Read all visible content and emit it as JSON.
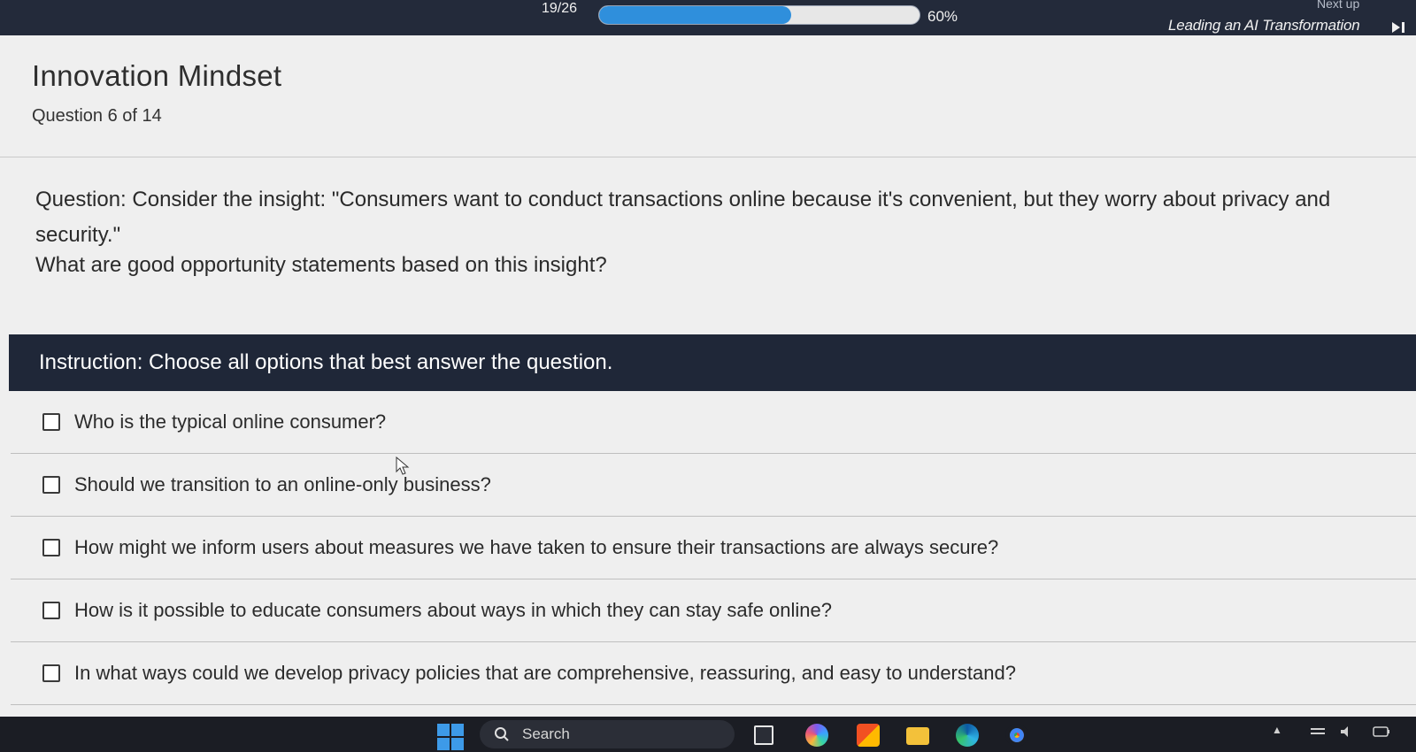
{
  "header": {
    "progress_count": "19/26",
    "progress_fraction": 0.6,
    "progress_percent": "60%",
    "next_up_label": "Next up",
    "next_up_title": "Leading an AI Transformation"
  },
  "quiz": {
    "title": "Innovation Mindset",
    "progress": "Question 6 of 14",
    "question_label": "Question:",
    "question_text": "Consider the insight: \"Consumers want to conduct transactions online because it's convenient, but they worry about privacy and security.\"",
    "question_prompt": "What are good opportunity statements based on this insight?",
    "instruction": "Instruction: Choose all options that best answer the question.",
    "options": [
      {
        "label": "Who is the typical online consumer?",
        "checked": false
      },
      {
        "label": "Should we transition to an online-only business?",
        "checked": false
      },
      {
        "label": "How might we inform users about measures we have taken to ensure their transactions are always secure?",
        "checked": false
      },
      {
        "label": "How is it possible to educate consumers about ways in which they can stay safe online?",
        "checked": false
      },
      {
        "label": "In what ways could we develop privacy policies that are comprehensive, reassuring, and easy to understand?",
        "checked": false
      }
    ]
  },
  "taskbar": {
    "search_placeholder": "Search",
    "icons": [
      "windows-start-icon",
      "search-icon",
      "file-explorer-icon",
      "copilot-icon",
      "store-icon",
      "folder-icon",
      "edge-icon",
      "chrome-icon"
    ]
  },
  "colors": {
    "header_bg": "#232a3a",
    "instruction_bg": "#1f2738",
    "progress_fill": "#2f8fdc",
    "content_bg": "#efefef"
  }
}
